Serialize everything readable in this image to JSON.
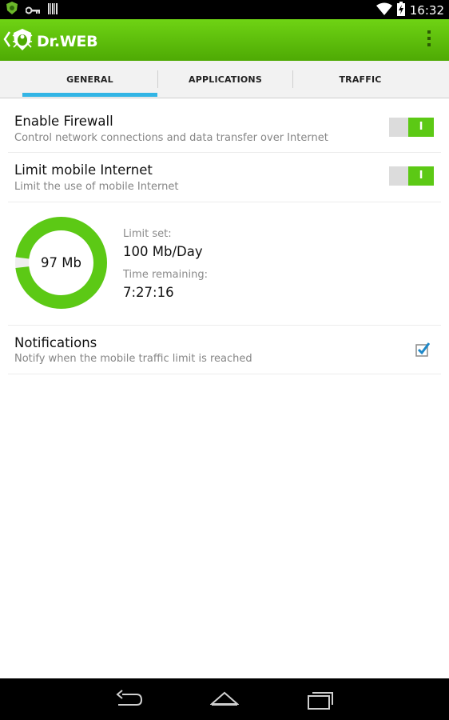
{
  "status_bar": {
    "time": "16:32",
    "icons": [
      "drweb-shield-icon",
      "key-icon",
      "barcode-icon",
      "wifi-icon",
      "battery-charging-icon"
    ]
  },
  "app": {
    "logo_text": "Dr.WEB",
    "brand_color": "#5cbf0c"
  },
  "tabs": [
    {
      "label": "GENERAL",
      "selected": true
    },
    {
      "label": "APPLICATIONS",
      "selected": false
    },
    {
      "label": "TRAFFIC",
      "selected": false
    }
  ],
  "settings": {
    "firewall": {
      "title": "Enable Firewall",
      "subtitle": "Control network connections and data transfer over Internet",
      "enabled": true,
      "toggle_glyph": "I"
    },
    "mobile_limit": {
      "title": "Limit mobile Internet",
      "subtitle": "Limit the use of mobile Internet",
      "enabled": true,
      "toggle_glyph": "I"
    },
    "usage": {
      "used_label": "97 Mb",
      "used_fraction": 0.97,
      "limit_label": "Limit set:",
      "limit_value": "100 Mb/Day",
      "remaining_label": "Time remaining:",
      "remaining_value": "7:27:16"
    },
    "notifications": {
      "title": "Notifications",
      "subtitle": "Notify when the mobile traffic limit is reached",
      "checked": true
    }
  },
  "colors": {
    "accent_green": "#5cc915",
    "tab_indicator": "#33b5e5",
    "checkbox": "#1e88c8"
  },
  "nav_bar": {
    "buttons": [
      "back-icon",
      "home-icon",
      "recent-apps-icon"
    ]
  }
}
